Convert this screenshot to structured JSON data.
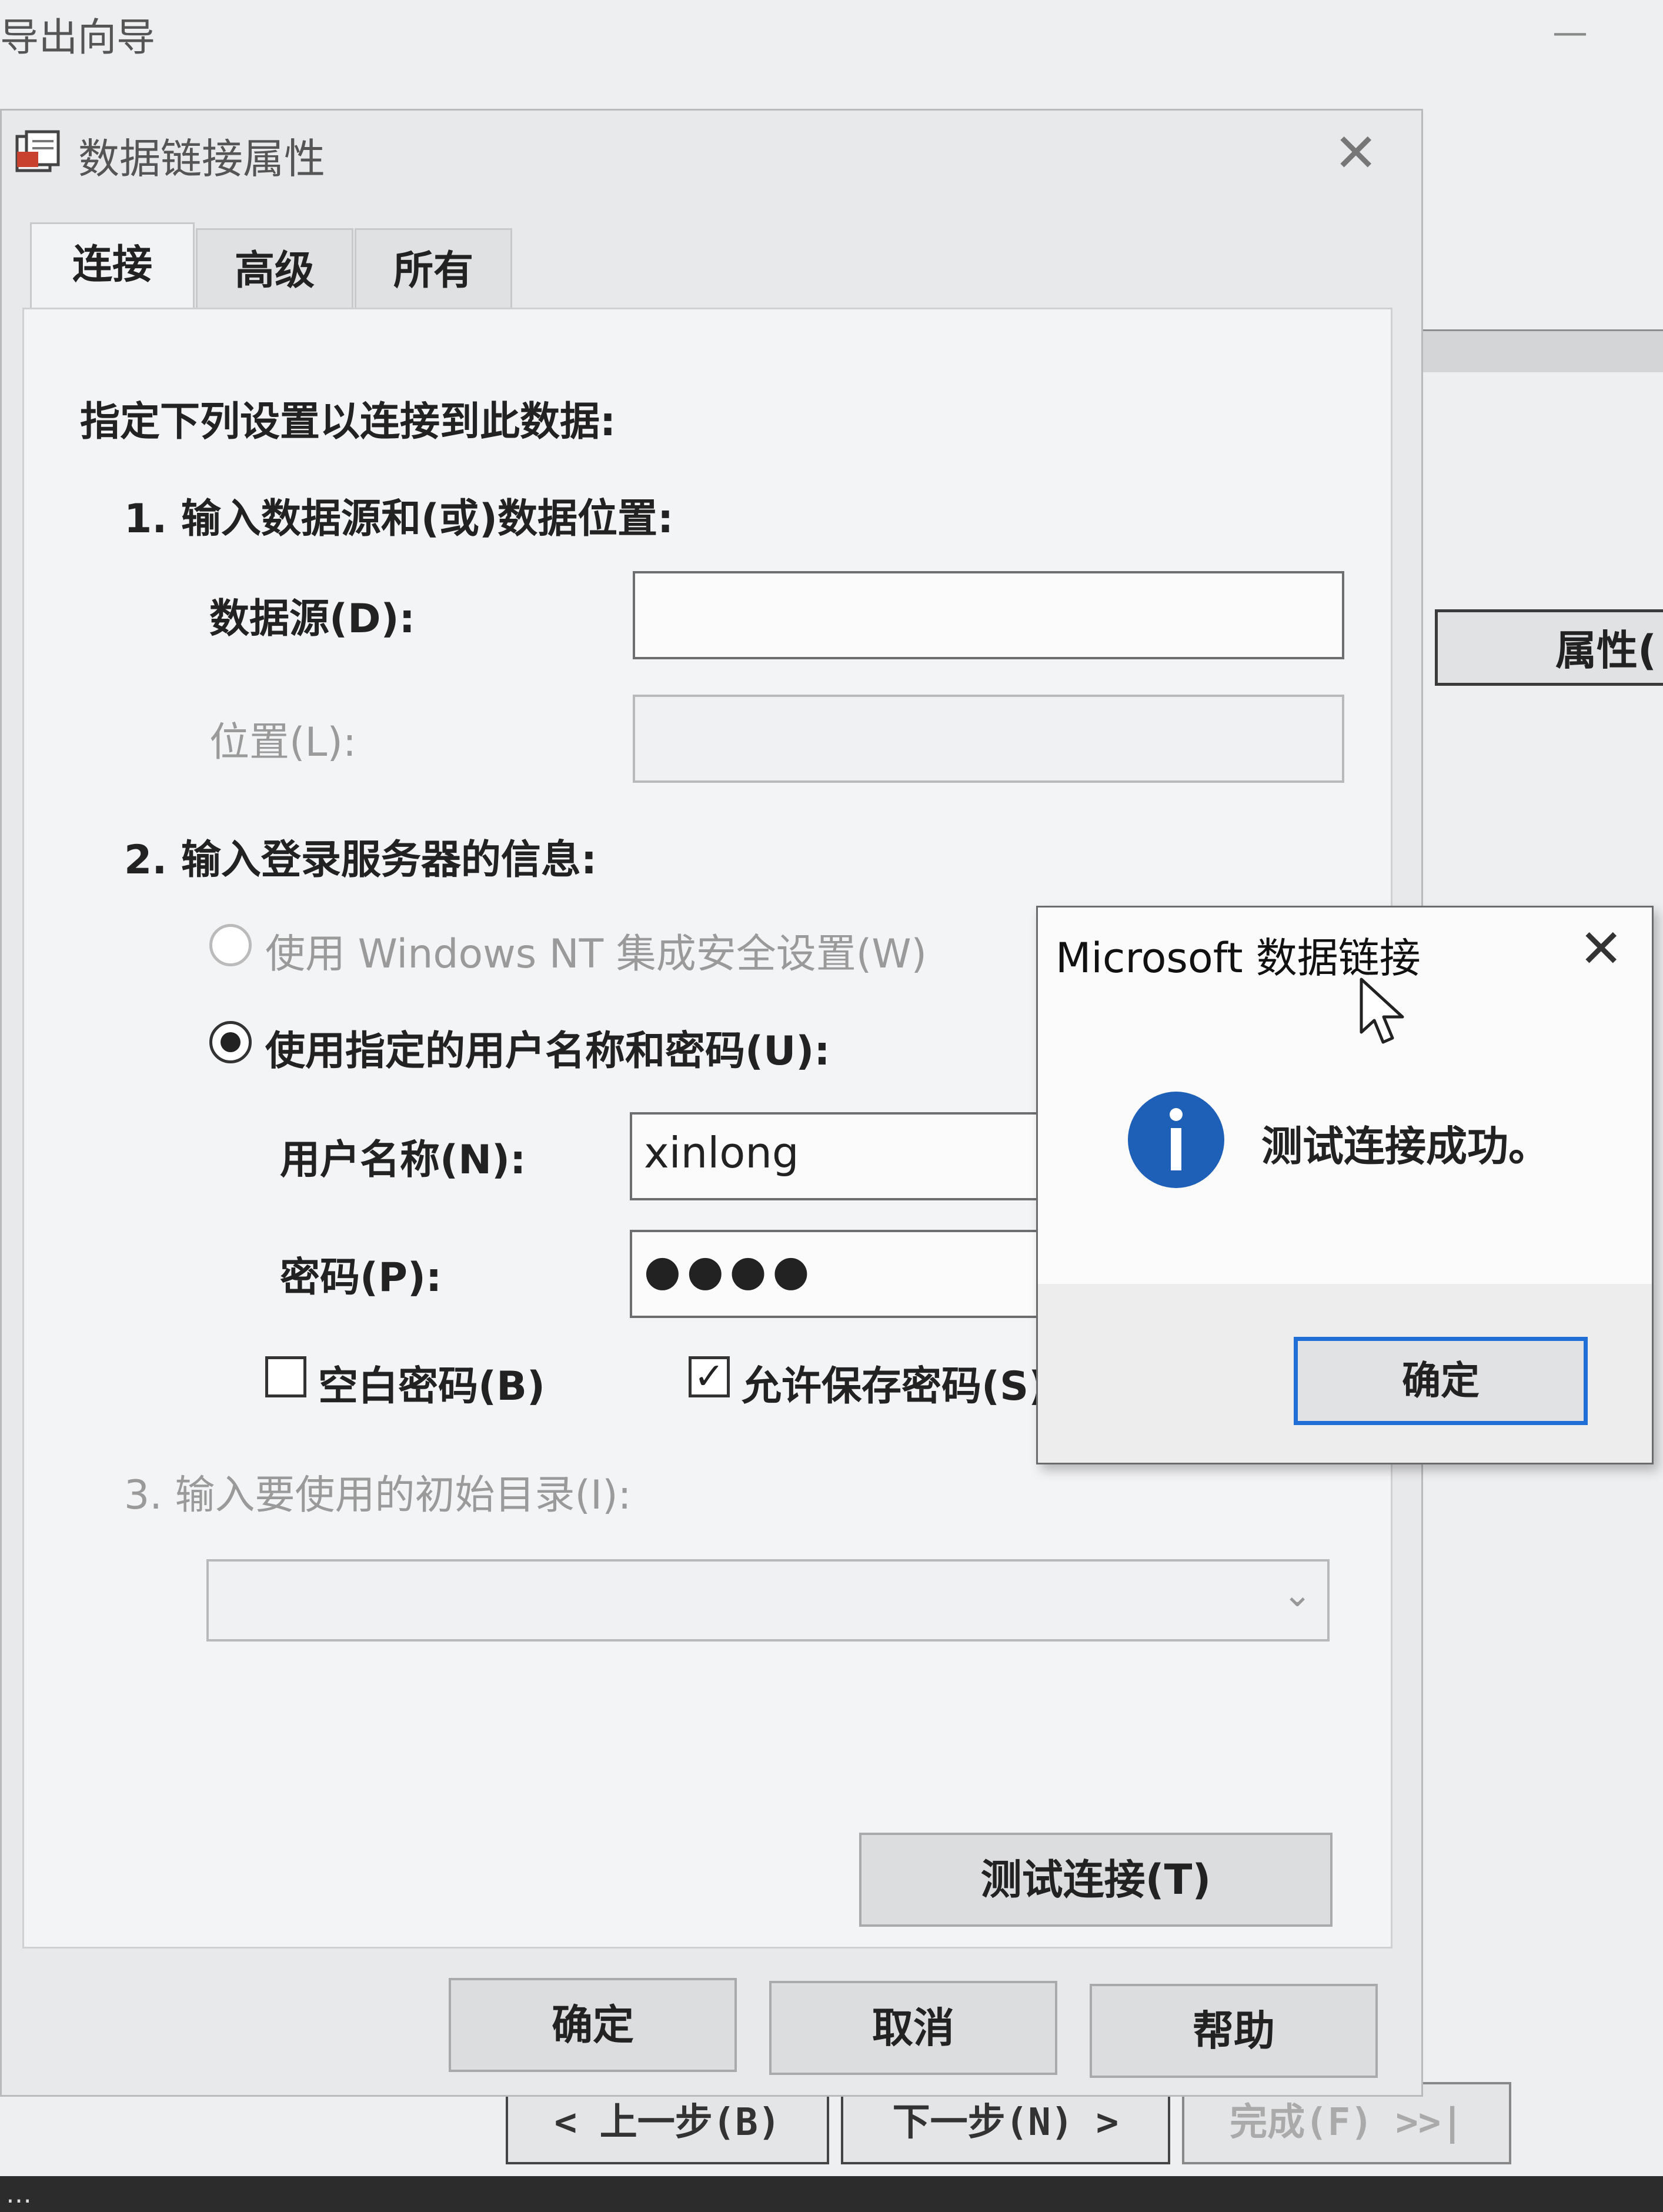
{
  "background_wizard": {
    "title": "导出向导",
    "minimize_glyph": "—",
    "properties_button": "属性(",
    "nav_buttons": {
      "back": "< 上一步(B)",
      "next": "下一步(N) >",
      "finish": "完成(F) >>|"
    },
    "status_text": "…"
  },
  "dialog": {
    "title": "数据链接属性",
    "tabs": [
      "连接",
      "高级",
      "所有"
    ],
    "intro": "指定下列设置以连接到此数据:",
    "step1": "1. 输入数据源和(或)数据位置:",
    "datasource_label": "数据源(D):",
    "datasource_value": "",
    "location_label": "位置(L):",
    "location_value": "",
    "step2": "2. 输入登录服务器的信息:",
    "radio_nt": "使用 Windows NT 集成安全设置(W)",
    "radio_user": "使用指定的用户名称和密码(U):",
    "username_label": "用户名称(N):",
    "username_value": "xinlong",
    "password_label": "密码(P):",
    "password_value": "●●●●",
    "blank_pw": "空白密码(B)",
    "allow_save": "允许保存密码(S)",
    "check_mark": "✓",
    "step3": "3. 输入要使用的初始目录(I):",
    "catalog_value": "",
    "test_button": "测试连接(T)",
    "ok": "确定",
    "cancel": "取消",
    "help": "帮助"
  },
  "message_box": {
    "title": "Microsoft 数据链接",
    "message": "测试连接成功。",
    "ok": "确定"
  },
  "colors": {
    "accent_focus": "#1f6fd6",
    "info_icon": "#1e5fb8"
  }
}
